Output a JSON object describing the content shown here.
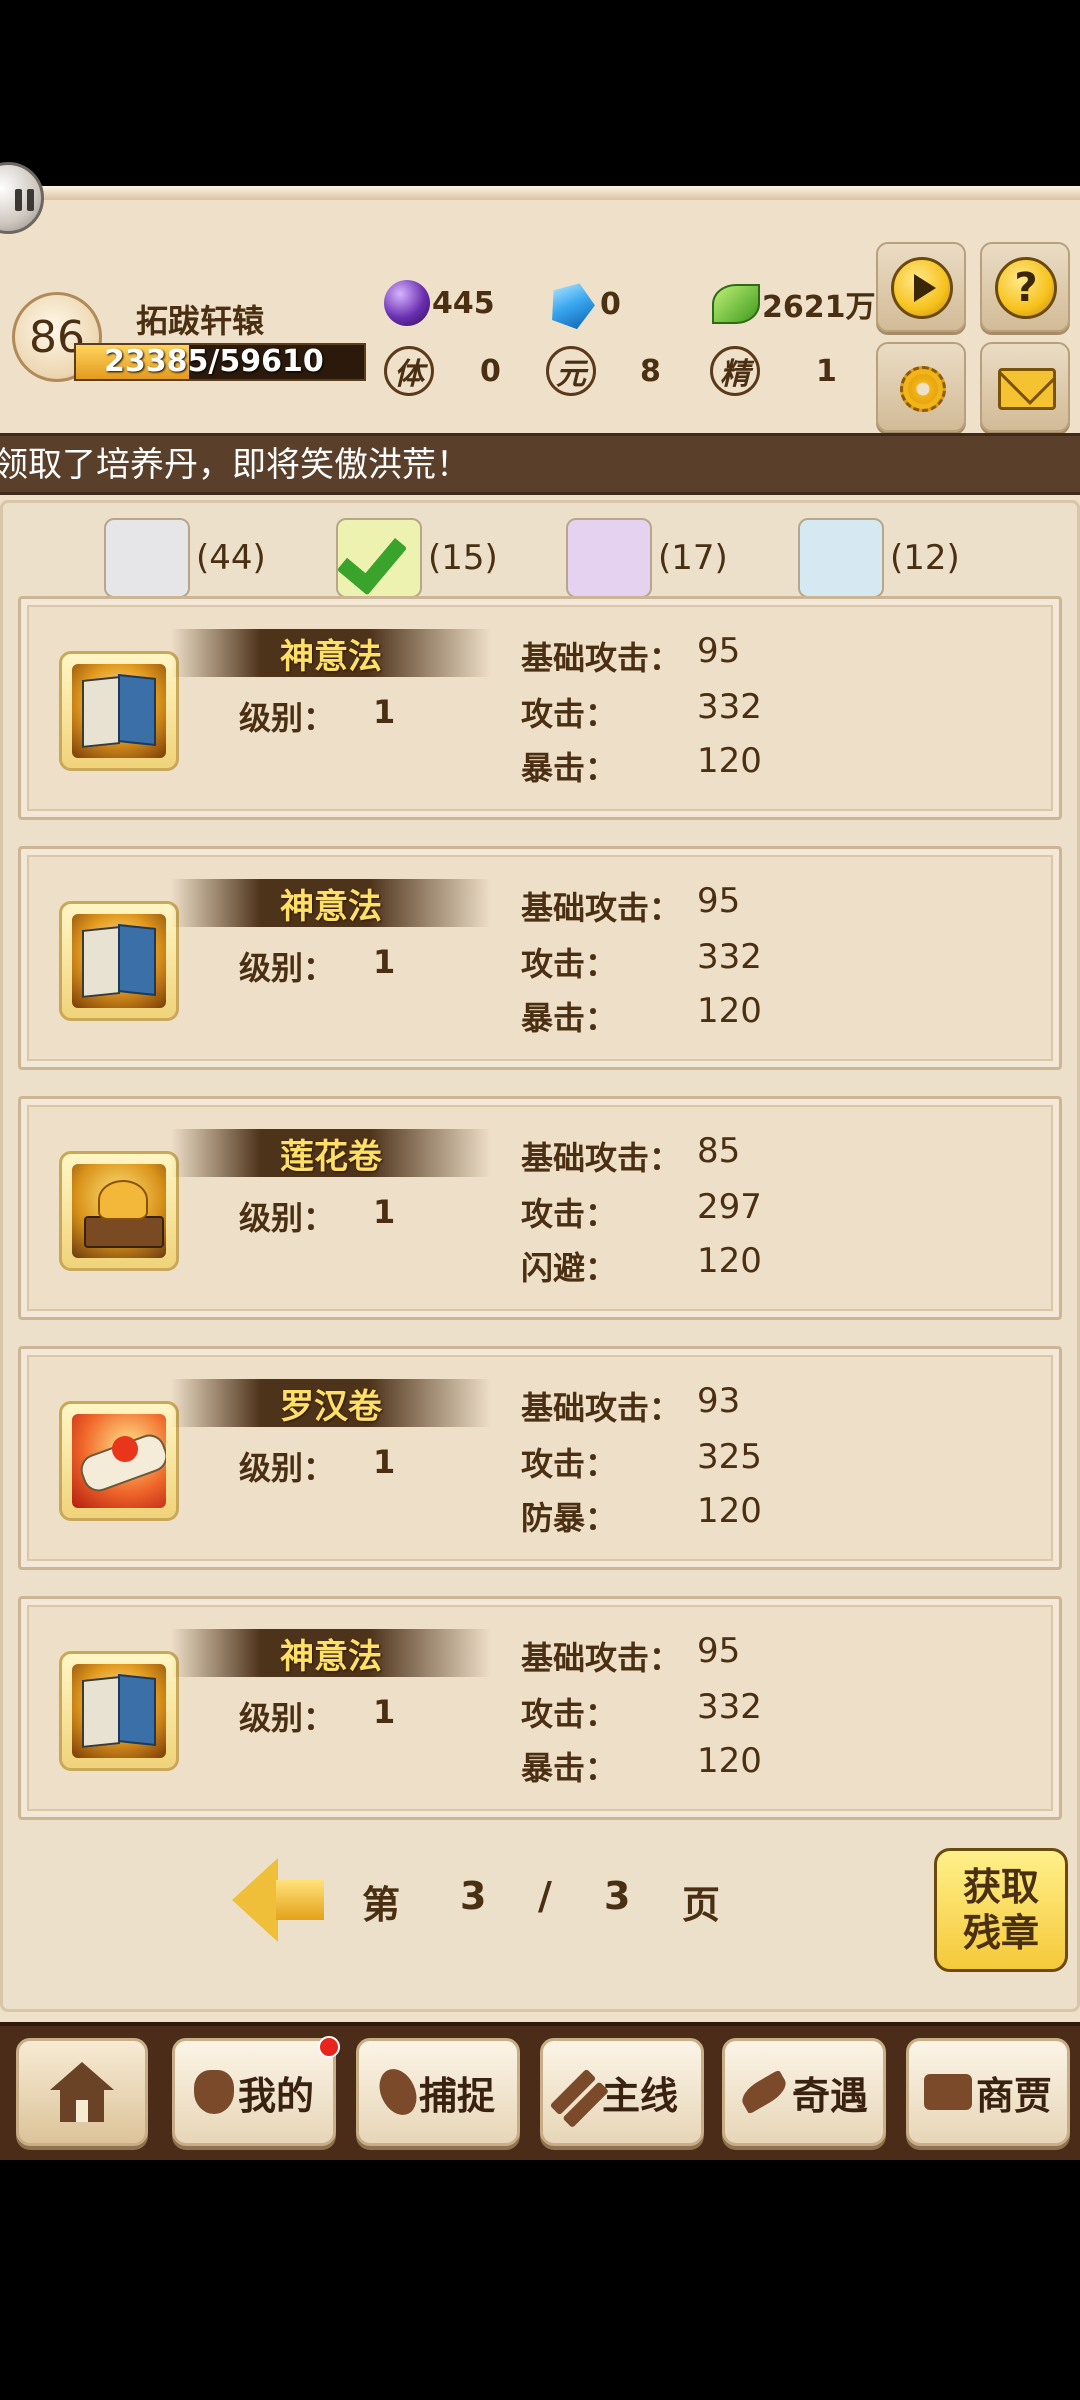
{
  "player": {
    "level": "86",
    "name": "拓跋轩辕",
    "exp_text": "23385/59610",
    "exp_fraction": 0.392
  },
  "resources": {
    "purple_gem": "445",
    "blue_diamond": "0",
    "green_coin": "2621万",
    "icons": [
      "purple-gem-icon",
      "blue-diamond-icon",
      "green-leaf-coin-icon"
    ]
  },
  "stats": [
    {
      "seal": "体",
      "value": "0"
    },
    {
      "seal": "元",
      "value": "8"
    },
    {
      "seal": "精",
      "value": "1"
    }
  ],
  "marquee": "领取了培养丹，即将笑傲洪荒！",
  "filters": [
    {
      "count": "(44)",
      "color": "#e6e6e9"
    },
    {
      "count": "(15)",
      "color": "#eef2b0"
    },
    {
      "count": "(17)",
      "color": "#e4d2f0"
    },
    {
      "count": "(12)",
      "color": "#d6e9f3"
    }
  ],
  "level_label": "级别：",
  "items": [
    {
      "name": "神意法",
      "level": "1",
      "icon": "book-icon",
      "stats": [
        {
          "label": "基础攻击：",
          "value": "95"
        },
        {
          "label": "攻击：",
          "value": "332"
        },
        {
          "label": "暴击：",
          "value": "120"
        }
      ]
    },
    {
      "name": "神意法",
      "level": "1",
      "icon": "book-icon",
      "stats": [
        {
          "label": "基础攻击：",
          "value": "95"
        },
        {
          "label": "攻击：",
          "value": "332"
        },
        {
          "label": "暴击：",
          "value": "120"
        }
      ]
    },
    {
      "name": "莲花卷",
      "level": "1",
      "icon": "lotus-icon",
      "stats": [
        {
          "label": "基础攻击：",
          "value": "85"
        },
        {
          "label": "攻击：",
          "value": "297"
        },
        {
          "label": "闪避：",
          "value": "120"
        }
      ]
    },
    {
      "name": "罗汉卷",
      "level": "1",
      "icon": "scroll-icon",
      "stats": [
        {
          "label": "基础攻击：",
          "value": "93"
        },
        {
          "label": "攻击：",
          "value": "325"
        },
        {
          "label": "防暴：",
          "value": "120"
        }
      ]
    },
    {
      "name": "神意法",
      "level": "1",
      "icon": "book-icon",
      "stats": [
        {
          "label": "基础攻击：",
          "value": "95"
        },
        {
          "label": "攻击：",
          "value": "332"
        },
        {
          "label": "暴击：",
          "value": "120"
        }
      ]
    }
  ],
  "pager": {
    "prefix": "第",
    "current": "3",
    "sep": "/",
    "total": "3",
    "suffix": "页"
  },
  "get_button": {
    "line1": "获取",
    "line2": "残章"
  },
  "nav": [
    {
      "label": "",
      "icon": "home-icon"
    },
    {
      "label": "我的",
      "icon": "bag-icon"
    },
    {
      "label": "捕捉",
      "icon": "net-icon"
    },
    {
      "label": "主线",
      "icon": "crossed-swords-icon"
    },
    {
      "label": "奇遇",
      "icon": "feather-icon"
    },
    {
      "label": "商贾",
      "icon": "chest-icon"
    }
  ]
}
